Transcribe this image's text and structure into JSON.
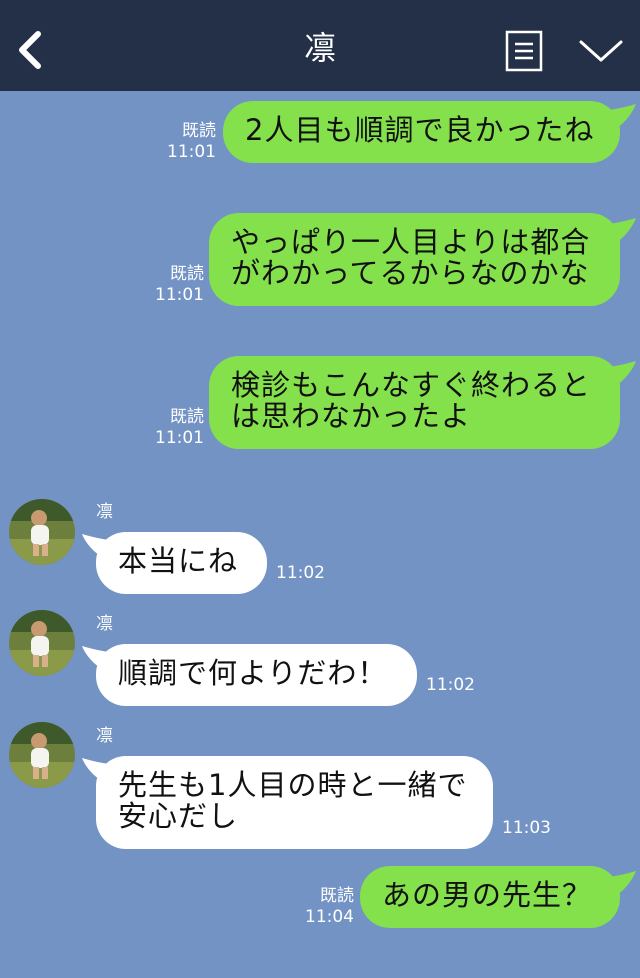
{
  "header": {
    "title": "凛",
    "icons": {
      "back": "chevron-left-icon",
      "notes": "note-icon",
      "menu": "chevron-down-icon"
    },
    "background": "#243047"
  },
  "colors": {
    "chat_background": "#7393c4",
    "my_bubble": "#84e14c",
    "their_bubble": "#ffffff"
  },
  "messages": [
    {
      "from": "me",
      "text": "2人目も順調で良かったね",
      "read": "既読",
      "time": "11:01"
    },
    {
      "from": "me",
      "text": "やっぱり一人目よりは都合\nがわかってるからなのかな",
      "read": "既読",
      "time": "11:01"
    },
    {
      "from": "me",
      "text": "検診もこんなすぐ終わると\nは思わなかったよ",
      "read": "既読",
      "time": "11:01"
    },
    {
      "from": "them",
      "sender": "凛",
      "text": "本当にね",
      "time": "11:02"
    },
    {
      "from": "them",
      "sender": "凛",
      "text": "順調で何よりだわ！",
      "time": "11:02"
    },
    {
      "from": "them",
      "sender": "凛",
      "text": "先生も1人目の時と一緒で\n安心だし",
      "time": "11:03"
    },
    {
      "from": "me",
      "text": "あの男の先生？",
      "read": "既読",
      "time": "11:04"
    }
  ]
}
